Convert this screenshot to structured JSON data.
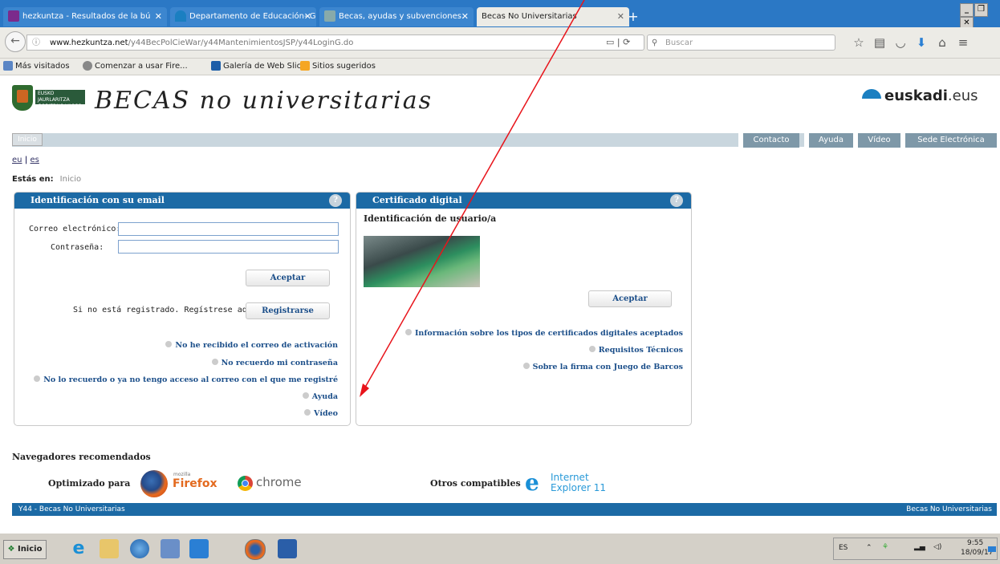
{
  "browser": {
    "tabs": [
      {
        "label": "hezkuntza - Resultados de la bú",
        "active": false
      },
      {
        "label": "Departamento de Educación- G",
        "active": false
      },
      {
        "label": "Becas, ayudas y subvenciones.",
        "active": false
      },
      {
        "label": "Becas No Universitarias",
        "active": true
      }
    ],
    "window_buttons": [
      "_",
      "&",
      "X"
    ],
    "url_domain": "www.hezkuntza.net",
    "url_path": "/y44BecPolCieWar/y44MantenimientosJSP/y44LoginG.do",
    "search_placeholder": "Buscar",
    "bookmarks": [
      "Más visitados",
      "Comenzar a usar Fire...",
      "Galería de Web Slice",
      "Sitios sugeridos"
    ]
  },
  "header": {
    "logo_text": "EUSKO JAURLARITZA GOBIERNO VASCO",
    "site_title": "BECAS no universitarias",
    "brand_main": "euskadi",
    "brand_suffix": ".eus"
  },
  "nav": {
    "home": "Inicio",
    "buttons": [
      "Contacto",
      "Ayuda",
      "Vídeo",
      "Sede Electrónica"
    ]
  },
  "langs": [
    "eu",
    "es"
  ],
  "breadcrumb": {
    "label": "Estás en:",
    "value": "Inicio"
  },
  "email_panel": {
    "title": "Identificación con su email",
    "email_label": "Correo electrónico:",
    "password_label": "Contraseña:",
    "accept": "Aceptar",
    "register_text": "Si no está registrado. Regístrese aquí",
    "register_button": "Registrarse",
    "links": [
      "No he recibido el correo de activación",
      "No recuerdo mi contraseña",
      "No lo recuerdo o ya no tengo acceso al correo con el que me registré",
      "Ayuda",
      "Vídeo"
    ]
  },
  "cert_panel": {
    "title": "Certificado digital",
    "subtitle": "Identificación de usuario/a",
    "accept": "Aceptar",
    "links": [
      "Información sobre los tipos de certificados digitales aceptados",
      "Requisitos Técnicos",
      "Sobre la firma con Juego de Barcos"
    ]
  },
  "browsers": {
    "title": "Navegadores recomendados",
    "optimized": "Optimizado para",
    "firefox_small": "mozilla",
    "firefox": "Firefox",
    "chrome": "chrome",
    "others": "Otros compatibles",
    "ie_line1": "Internet",
    "ie_line2": "Explorer 11"
  },
  "footer": {
    "left": "Y44 - Becas No Universitarias",
    "right": "Becas No Universitarias"
  },
  "taskbar": {
    "start": "Inicio",
    "lang": "ES",
    "time": "9:55",
    "date": "18/09/17"
  },
  "colors": {
    "header_blue": "#1c6aa5",
    "nav_grey": "#7e98a8",
    "link_blue": "#1c4f8a",
    "arrow_red": "#e8141b"
  }
}
